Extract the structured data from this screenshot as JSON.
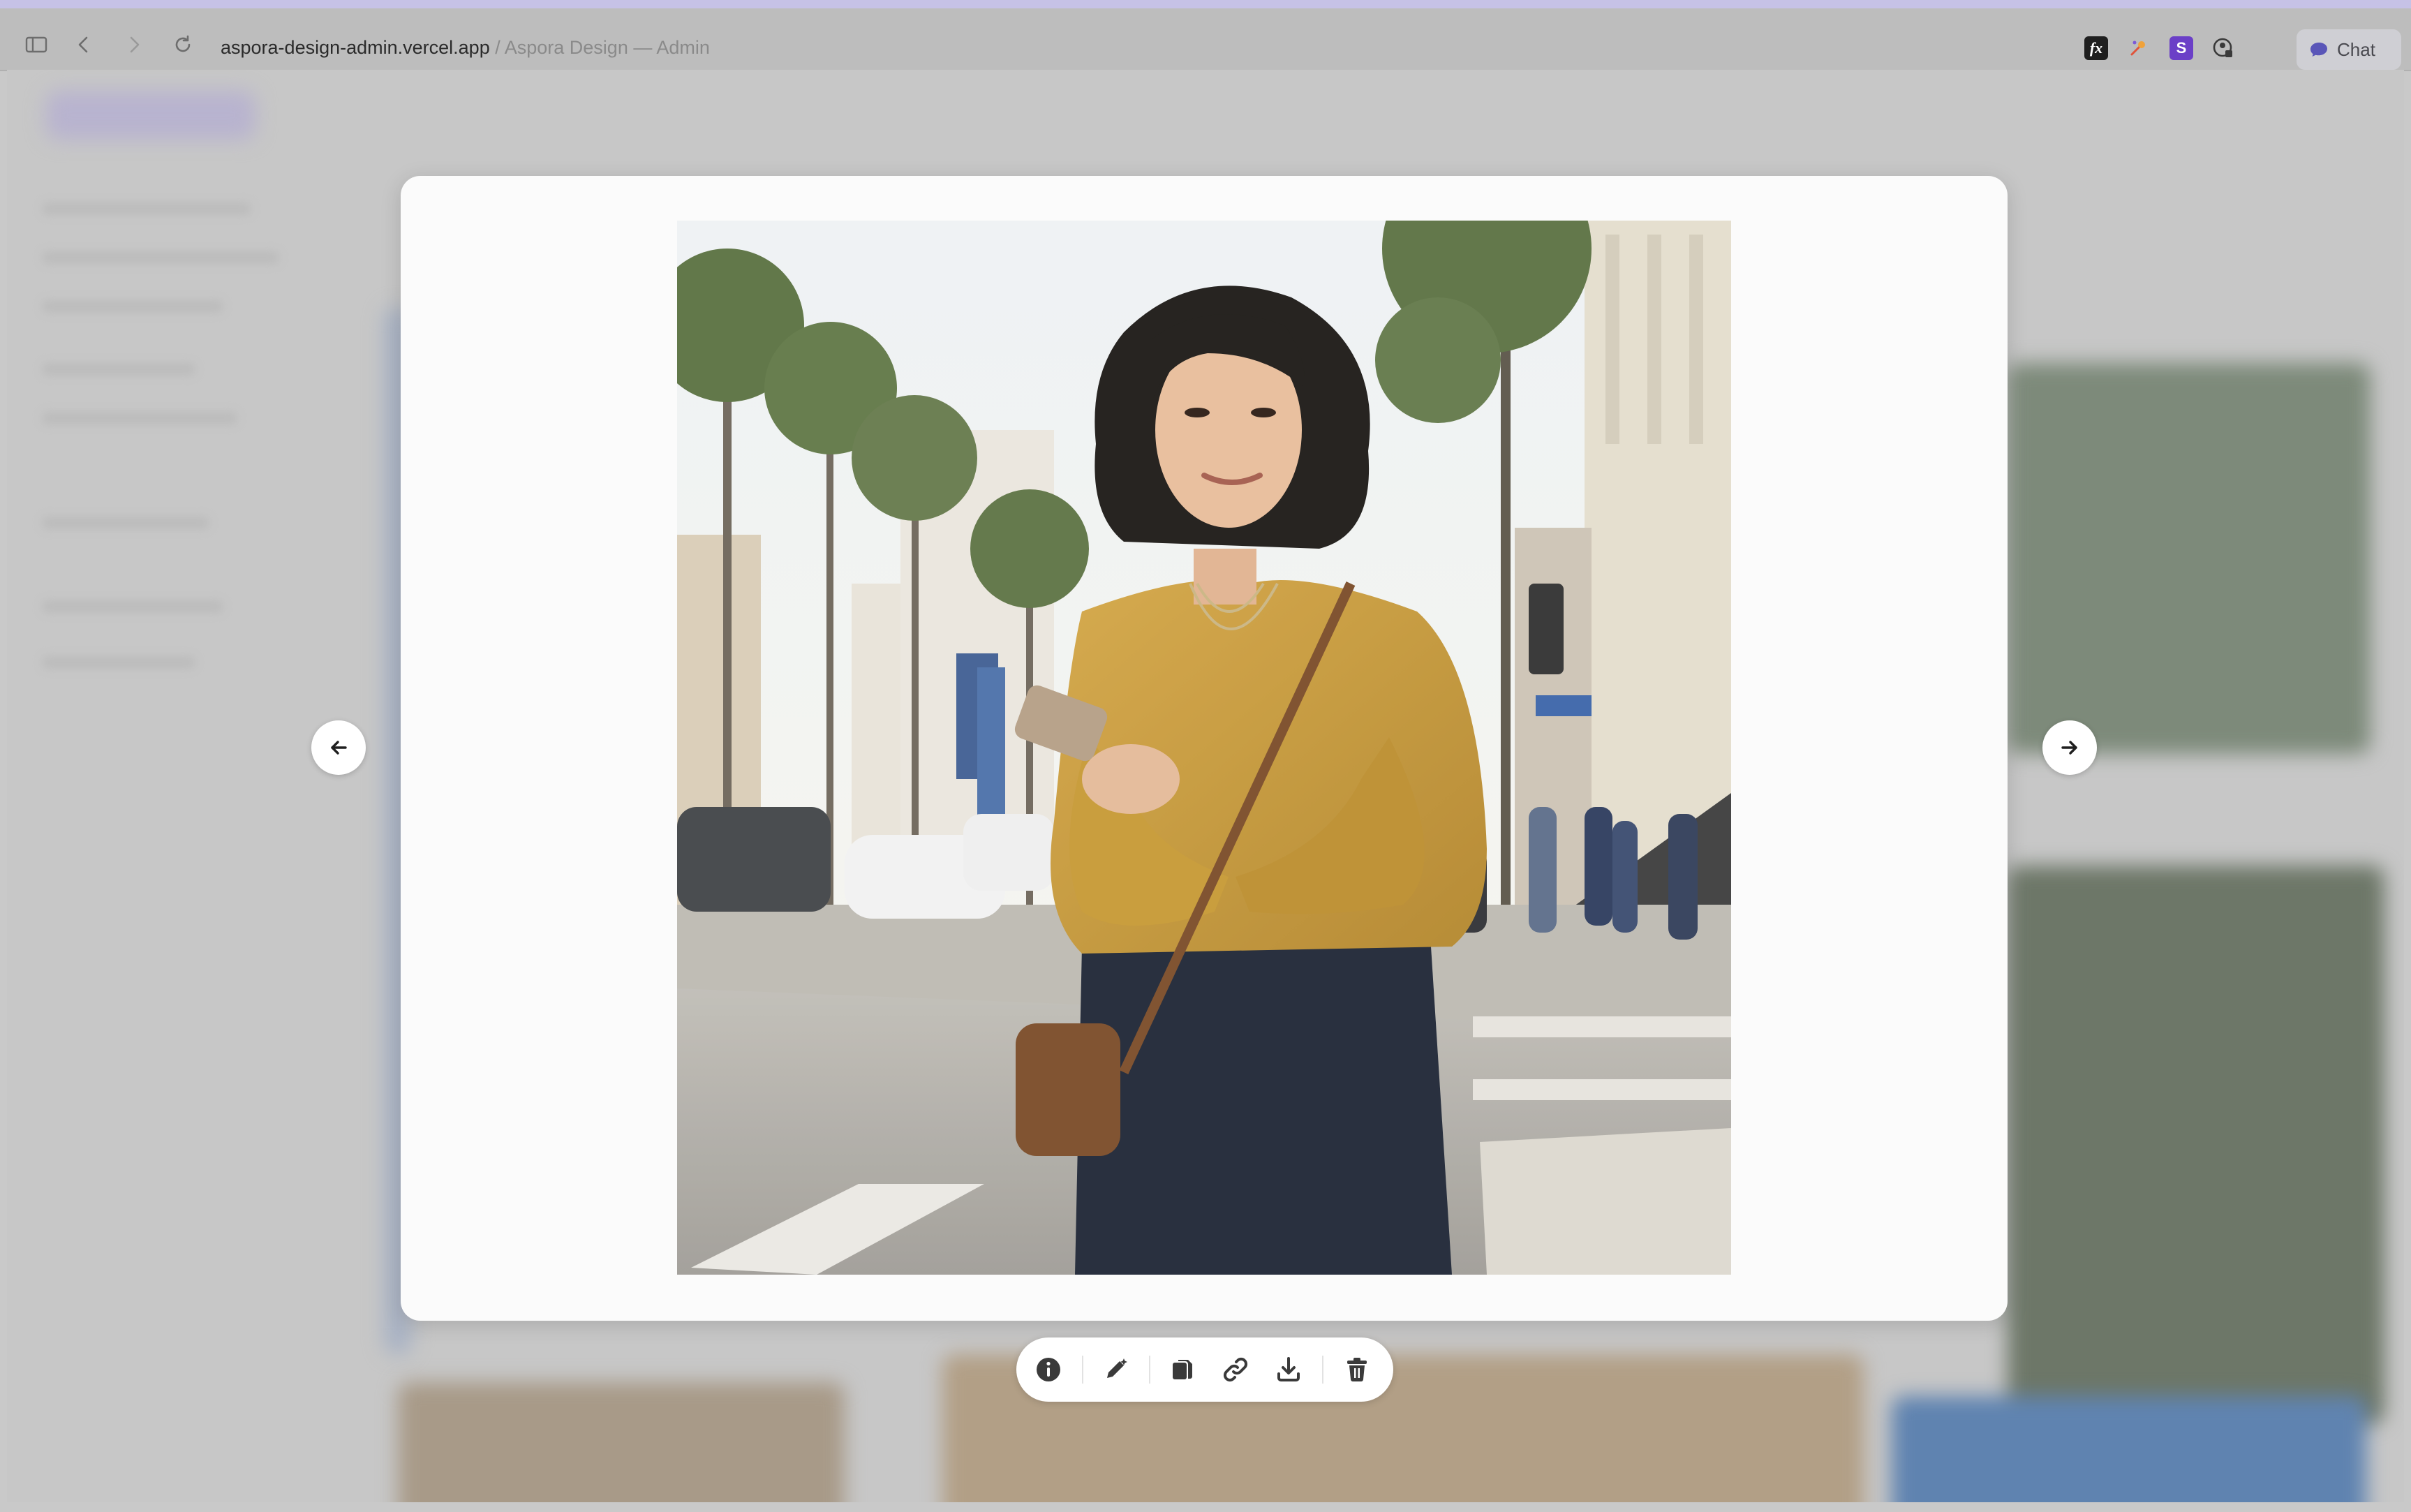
{
  "browser": {
    "url_host": "aspora-design-admin.vercel.app",
    "url_separator": " / ",
    "page_title": "Aspora Design — Admin",
    "icons": [
      "sidebar-toggle-icon",
      "back-icon",
      "forward-icon",
      "reload-icon"
    ],
    "extensions": {
      "fx_label": "fx",
      "s_label": "S"
    },
    "chat_label": "Chat"
  },
  "viewer": {
    "image_alt": "Woman in a mustard sweater holding a phone on a palm-lined city street",
    "prev_icon": "arrow-left-icon",
    "next_icon": "arrow-right-icon",
    "actions": [
      "info-icon",
      "edit-icon",
      "copy-icon",
      "link-icon",
      "download-icon",
      "trash-icon"
    ]
  },
  "colors": {
    "accent_stripe": "#c6c2e6",
    "toolbar": "#bdbdbd",
    "modal": "#fbfbfb",
    "sweater": "#c99a34",
    "extension_s": "#6b3fc7"
  }
}
